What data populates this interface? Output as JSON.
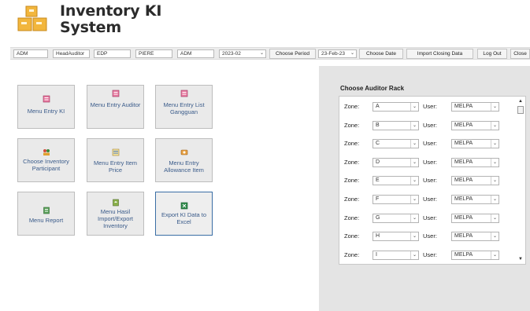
{
  "app": {
    "title_line1": "Inventory KI",
    "title_line2": "System"
  },
  "toolbar": {
    "user_dept": "ADM",
    "user_role": "HeadAuditor",
    "site_code": "EDP",
    "user_name": "PIERE",
    "module": "ADM",
    "period_value": "2023-02",
    "choose_period_label": "Choose Period",
    "date_value": "23-Feb-23",
    "choose_date_label": "Choose Date",
    "import_closing_label": "Import Closing Data",
    "logout_label": "Log Out",
    "close_label": "Close"
  },
  "menu": {
    "entry_ki": "Menu Entry KI",
    "entry_auditor": "Menu Entry Auditor",
    "entry_list_gangguan": "Menu Entry List Gangguan",
    "choose_inventory_participant": "Choose Inventory Participant",
    "entry_item_price": "Menu Entry Item Price",
    "entry_allowance_item": "Menu Entry Allowance Item",
    "report": "Menu Report",
    "hasil_import_export": "Menu Hasil Import/Export Inventory",
    "export_ki_excel": "Export KI Data to Excel"
  },
  "rack_panel": {
    "title": "Choose Auditor Rack",
    "zone_label": "Zone:",
    "user_label": "User:",
    "rows": [
      {
        "zone": "A",
        "user": "MELPA"
      },
      {
        "zone": "B",
        "user": "MELPA"
      },
      {
        "zone": "C",
        "user": "MELPA"
      },
      {
        "zone": "D",
        "user": "MELPA"
      },
      {
        "zone": "E",
        "user": "MELPA"
      },
      {
        "zone": "F",
        "user": "MELPA"
      },
      {
        "zone": "G",
        "user": "MELPA"
      },
      {
        "zone": "H",
        "user": "MELPA"
      },
      {
        "zone": "I",
        "user": "MELPA"
      }
    ]
  },
  "colors": {
    "accent_text": "#3a5b8a",
    "logo": "#f0b43c",
    "panel_bg": "#e4e4e4"
  }
}
